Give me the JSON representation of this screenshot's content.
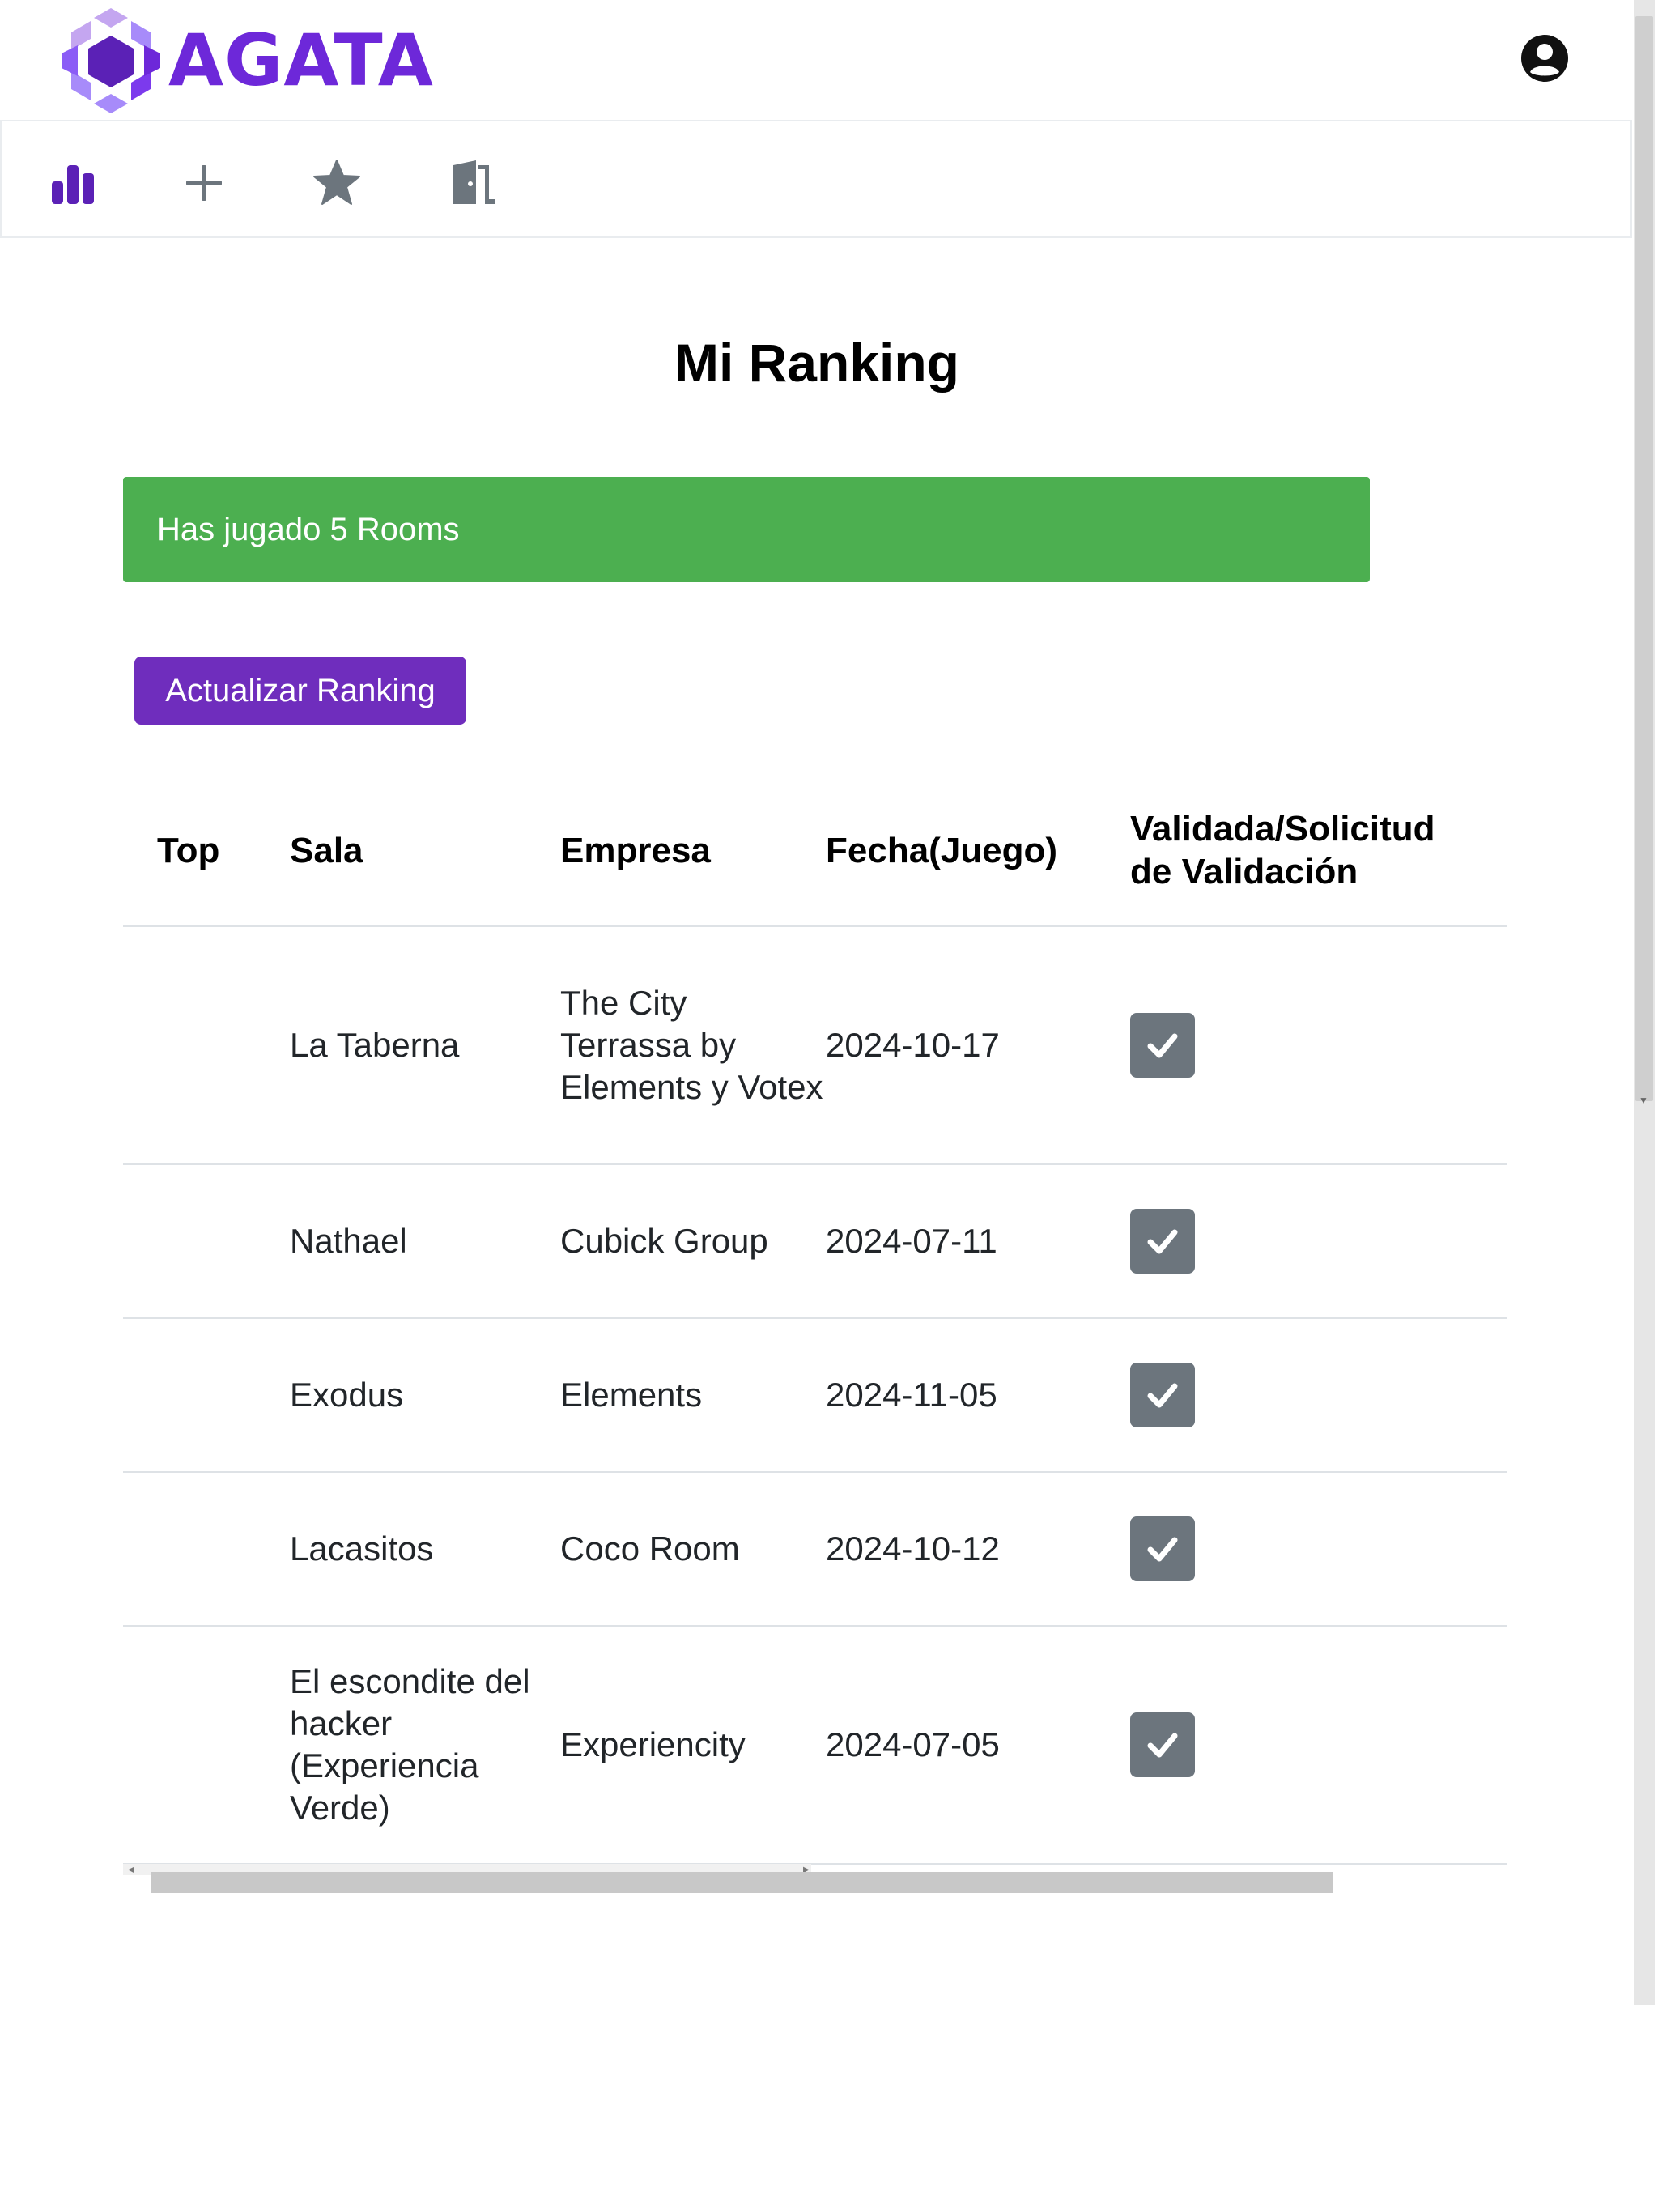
{
  "brand": {
    "name": "AGATA",
    "color": "#6d28d9"
  },
  "header": {
    "user_icon": "user-circle-icon"
  },
  "toolbar": {
    "items": [
      {
        "icon": "bar-chart-icon",
        "color": "#5b21b6"
      },
      {
        "icon": "plus-icon",
        "color": "#6c757d"
      },
      {
        "icon": "star-icon",
        "color": "#6c757d"
      },
      {
        "icon": "door-exit-icon",
        "color": "#6c757d"
      }
    ]
  },
  "page": {
    "title": "Mi Ranking",
    "alert": "Has jugado 5 Rooms",
    "alert_color": "#4caf50",
    "update_button": "Actualizar Ranking",
    "update_button_color": "#6f2dbd"
  },
  "table": {
    "headers": {
      "top": "Top",
      "sala": "Sala",
      "empresa": "Empresa",
      "fecha": "Fecha(Juego)",
      "validada": "Validada/Solicitud de Validación"
    },
    "rows": [
      {
        "top": "",
        "sala": "La Taberna",
        "empresa": "The City Terrassa by Elements y Votex",
        "fecha": "2024-10-17",
        "validada": true
      },
      {
        "top": "",
        "sala": "Nathael",
        "empresa": "Cubick Group",
        "fecha": "2024-07-11",
        "validada": true
      },
      {
        "top": "",
        "sala": "Exodus",
        "empresa": "Elements",
        "fecha": "2024-11-05",
        "validada": true
      },
      {
        "top": "",
        "sala": "Lacasitos",
        "empresa": "Coco Room",
        "fecha": "2024-10-12",
        "validada": true
      },
      {
        "top": "",
        "sala": "El escondite del hacker (Experiencia Verde)",
        "empresa": "Experiencity",
        "fecha": "2024-07-05",
        "validada": true
      }
    ]
  }
}
